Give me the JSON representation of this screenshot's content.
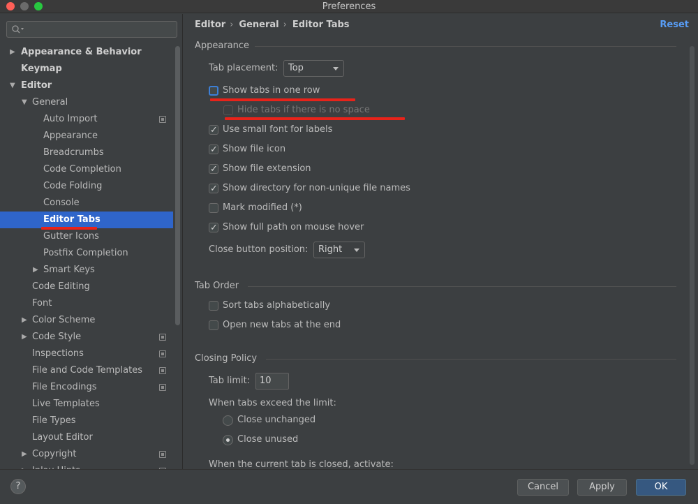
{
  "window": {
    "title": "Preferences"
  },
  "search": {
    "placeholder": ""
  },
  "sidebar": {
    "items": [
      {
        "label": "Appearance & Behavior",
        "level": 0,
        "bold": true,
        "arrow": "right"
      },
      {
        "label": "Keymap",
        "level": 0,
        "bold": true,
        "arrow": ""
      },
      {
        "label": "Editor",
        "level": 0,
        "bold": true,
        "arrow": "down"
      },
      {
        "label": "General",
        "level": 1,
        "arrow": "down"
      },
      {
        "label": "Auto Import",
        "level": 2,
        "icon": "project-settings-icon"
      },
      {
        "label": "Appearance",
        "level": 2
      },
      {
        "label": "Breadcrumbs",
        "level": 2
      },
      {
        "label": "Code Completion",
        "level": 2
      },
      {
        "label": "Code Folding",
        "level": 2
      },
      {
        "label": "Console",
        "level": 2
      },
      {
        "label": "Editor Tabs",
        "level": 2,
        "selected": true
      },
      {
        "label": "Gutter Icons",
        "level": 2
      },
      {
        "label": "Postfix Completion",
        "level": 2
      },
      {
        "label": "Smart Keys",
        "level": 2,
        "arrow": "right"
      },
      {
        "label": "Code Editing",
        "level": 1
      },
      {
        "label": "Font",
        "level": 1
      },
      {
        "label": "Color Scheme",
        "level": 1,
        "arrow": "right"
      },
      {
        "label": "Code Style",
        "level": 1,
        "arrow": "right",
        "icon": "project-settings-icon"
      },
      {
        "label": "Inspections",
        "level": 1,
        "icon": "project-settings-icon"
      },
      {
        "label": "File and Code Templates",
        "level": 1,
        "icon": "project-settings-icon"
      },
      {
        "label": "File Encodings",
        "level": 1,
        "icon": "project-settings-icon"
      },
      {
        "label": "Live Templates",
        "level": 1
      },
      {
        "label": "File Types",
        "level": 1
      },
      {
        "label": "Layout Editor",
        "level": 1
      },
      {
        "label": "Copyright",
        "level": 1,
        "arrow": "right",
        "icon": "project-settings-icon"
      },
      {
        "label": "Inlay Hints",
        "level": 1,
        "arrow": "right",
        "icon": "project-settings-icon"
      }
    ]
  },
  "breadcrumb": {
    "items": [
      "Editor",
      "General",
      "Editor Tabs"
    ],
    "separator": "›"
  },
  "reset_label": "Reset",
  "appearance": {
    "heading": "Appearance",
    "tab_placement": {
      "label": "Tab placement:",
      "value": "Top"
    },
    "show_tabs_one_row": {
      "label": "Show tabs in one row",
      "checked": false
    },
    "hide_tabs_no_space": {
      "label": "Hide tabs if there is no space",
      "checked": false,
      "disabled": true
    },
    "small_font": {
      "label": "Use small font for labels",
      "checked": true
    },
    "file_icon": {
      "label": "Show file icon",
      "checked": true
    },
    "file_extension": {
      "label": "Show file extension",
      "checked": true
    },
    "directory": {
      "label": "Show directory for non-unique file names",
      "checked": true
    },
    "mark_modified": {
      "label": "Mark modified (*)",
      "checked": false
    },
    "full_path": {
      "label": "Show full path on mouse hover",
      "checked": true
    },
    "close_button_position": {
      "label": "Close button position:",
      "value": "Right"
    }
  },
  "tab_order": {
    "heading": "Tab Order",
    "sort_alpha": {
      "label": "Sort tabs alphabetically",
      "checked": false
    },
    "open_at_end": {
      "label": "Open new tabs at the end",
      "checked": false
    }
  },
  "closing_policy": {
    "heading": "Closing Policy",
    "tab_limit": {
      "label": "Tab limit:",
      "value": "10"
    },
    "exceed_label": "When tabs exceed the limit:",
    "close_unchanged": {
      "label": "Close unchanged",
      "selected": false
    },
    "close_unused": {
      "label": "Close unused",
      "selected": true
    },
    "current_closed_label": "When the current tab is closed, activate:"
  },
  "footer": {
    "help_label": "?",
    "cancel_label": "Cancel",
    "apply_label": "Apply",
    "ok_label": "OK"
  },
  "colors": {
    "background": "#3c3f41",
    "selection": "#2f65ca",
    "accent_link": "#589df6",
    "primary_button": "#365880",
    "annotation_red": "#e8231a"
  }
}
